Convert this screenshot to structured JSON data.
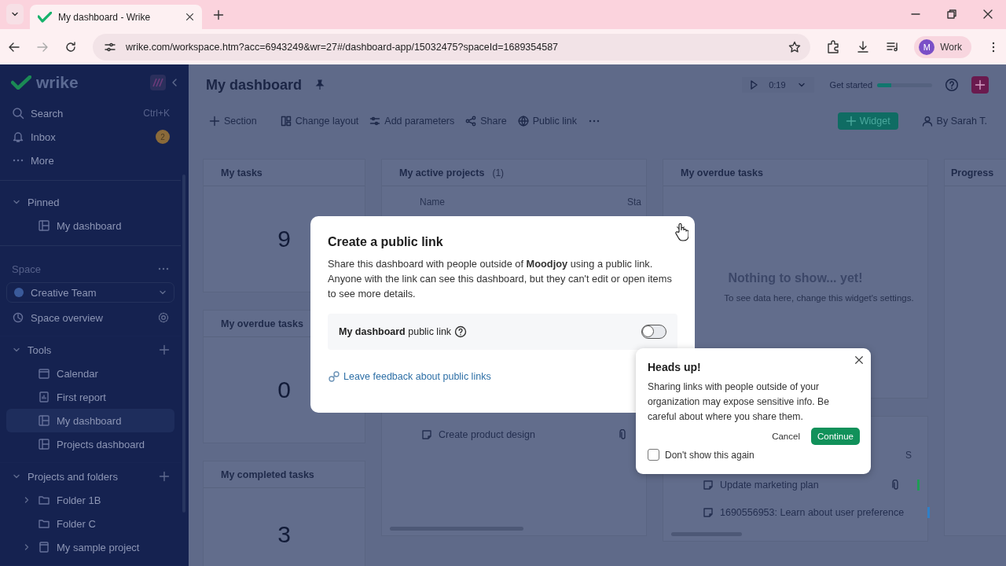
{
  "browser": {
    "tabs": [
      {
        "title": "My dashboard - Wrike",
        "selected": true
      }
    ],
    "url": "wrike.com/workspace.htm?acc=6943249&wr=27#/dashboard-app/15032475?spaceId=1689354587",
    "profile": {
      "initial": "M",
      "label": "Work"
    }
  },
  "sidebar": {
    "logo": "wrike",
    "top_items": [
      {
        "kind": "search",
        "label": "Search",
        "shortcut": "Ctrl+K"
      },
      {
        "kind": "inbox",
        "label": "Inbox",
        "badge": "2"
      },
      {
        "kind": "more",
        "label": "More"
      }
    ],
    "sections": [
      {
        "kind": "pinned",
        "label": "Pinned",
        "expanded": true,
        "items": [
          {
            "kind": "dashboard",
            "label": "My dashboard",
            "selected": false
          }
        ]
      },
      {
        "kind": "space",
        "label": "Space",
        "selector": "Creative Team",
        "overview": "Space overview"
      },
      {
        "kind": "tools",
        "label": "Tools",
        "expanded": true,
        "items": [
          {
            "kind": "calendar",
            "label": "Calendar",
            "selected": false
          },
          {
            "kind": "report",
            "label": "First report",
            "selected": false
          },
          {
            "kind": "dashboard",
            "label": "My dashboard",
            "selected": true
          },
          {
            "kind": "dashboard",
            "label": "Projects dashboard",
            "selected": false
          }
        ]
      },
      {
        "kind": "projects",
        "label": "Projects and folders",
        "expanded": true,
        "items": [
          {
            "kind": "folder",
            "label": "Folder 1B",
            "selected": false,
            "expandable": true
          },
          {
            "kind": "folder",
            "label": "Folder C",
            "selected": false,
            "expandable": false
          },
          {
            "kind": "project",
            "label": "My sample project",
            "selected": false,
            "expandable": true
          }
        ]
      }
    ]
  },
  "header": {
    "title": "My dashboard",
    "video_time": "0:19",
    "get_started": {
      "label": "Get started",
      "level": 0.25
    }
  },
  "toolbar": {
    "actions": [
      {
        "kind": "plus",
        "label": "Section"
      },
      {
        "kind": "layout",
        "label": "Change layout"
      },
      {
        "kind": "params",
        "label": "Add parameters"
      },
      {
        "kind": "share",
        "label": "Share"
      },
      {
        "kind": "globe",
        "label": "Public link"
      }
    ],
    "widget_button": "Widget",
    "owner": "By Sarah T."
  },
  "widgets": [
    {
      "kind": "count",
      "title": "My tasks",
      "value": "9"
    },
    {
      "kind": "count",
      "title": "My overdue tasks",
      "value": "0"
    },
    {
      "kind": "count",
      "title": "My completed tasks",
      "value": "3"
    },
    {
      "kind": "table",
      "title": "My active projects",
      "count": "(1)",
      "columns": [
        "Name",
        "Sta"
      ],
      "rows": [
        "Create product design"
      ]
    },
    {
      "kind": "empty",
      "title": "My overdue tasks",
      "message": "Nothing to show... yet!",
      "hint": "To see data here, change this widget's settings."
    },
    {
      "kind": "list",
      "columns": [
        "S"
      ],
      "rows": [
        {
          "label": "Update marketing plan",
          "color": "#1f9d55"
        },
        {
          "label": "1690556953: Learn about user preference",
          "color": "#2f80c8"
        }
      ]
    },
    {
      "kind": "partial",
      "title": "Progress"
    }
  ],
  "modal": {
    "title": "Create a public link",
    "description": "Share this dashboard with people outside of **Moodjoy** using a public link. Anyone with the link can see this dashboard, but they can't edit or open items to see more details.",
    "toggle": {
      "label": "**My dashboard** public link",
      "on": false
    },
    "feedback_link": "Leave feedback about public links"
  },
  "popover": {
    "title": "Heads up!",
    "text": "Sharing links with people outside of your organization may expose sensitive info. Be careful about where you share them.",
    "buttons": [
      {
        "kind": "secondary",
        "label": "Cancel"
      },
      {
        "kind": "primary",
        "label": "Continue"
      }
    ],
    "checkbox": {
      "label": "Don't show this again",
      "checked": false
    }
  }
}
